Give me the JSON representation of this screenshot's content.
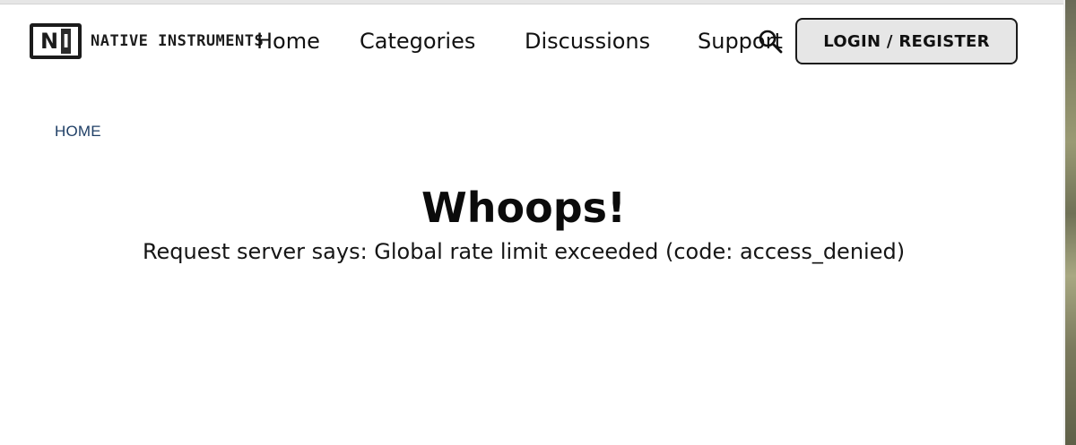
{
  "brand": {
    "logo_letter_n": "N",
    "logo_letter_i": "I",
    "name": "NATIVE INSTRUMENTS"
  },
  "nav": {
    "items": [
      {
        "label": "Home"
      },
      {
        "label": "Categories"
      },
      {
        "label": "Discussions"
      },
      {
        "label": "Support"
      }
    ],
    "search_icon": "search-icon",
    "login_label": "LOGIN / REGISTER"
  },
  "breadcrumb": {
    "home": "HOME"
  },
  "error": {
    "title": "Whoops!",
    "message": "Request server says: Global rate limit exceeded (code: access_denied)"
  },
  "colors": {
    "breadcrumb": "#1f3f66",
    "button_bg": "#e6e6e6",
    "text": "#111111"
  }
}
